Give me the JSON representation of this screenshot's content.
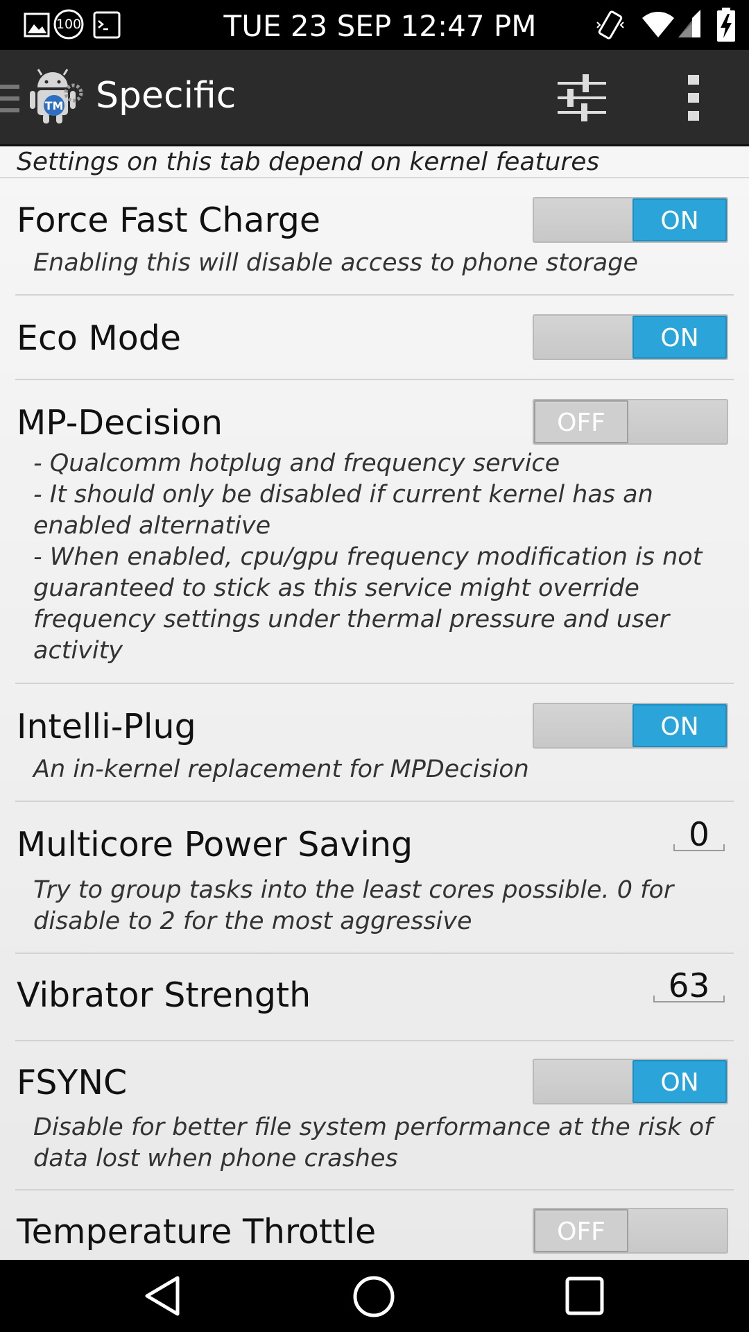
{
  "status_bar": {
    "time": "TUE 23 SEP 12:47 PM",
    "icons": [
      "picture-icon",
      "battery-100-badge-icon",
      "terminal-icon",
      "vibrate-icon",
      "wifi-icon",
      "signal-icon",
      "battery-charging-icon"
    ],
    "badge": "100"
  },
  "action_bar": {
    "title": "Specific",
    "icons": [
      "drawer-icon",
      "app-logo",
      "tune-sliders-icon",
      "overflow-menu-icon"
    ]
  },
  "tab_note": "Settings on this tab depend on kernel features",
  "settings": [
    {
      "title": "Force Fast Charge",
      "control": "toggle",
      "state": "ON",
      "description": "Enabling this will disable access to phone storage"
    },
    {
      "title": "Eco Mode",
      "control": "toggle",
      "state": "ON"
    },
    {
      "title": "MP-Decision",
      "control": "toggle",
      "state": "OFF",
      "description_lines": [
        "- Qualcomm hotplug and frequency service",
        "- It should only be disabled if current kernel has an",
        "enabled alternative",
        "- When enabled, cpu/gpu frequency modification is not",
        "guaranteed to stick as this service might override",
        "frequency settings under thermal pressure and user",
        "activity"
      ]
    },
    {
      "title": "Intelli-Plug",
      "control": "toggle",
      "state": "ON",
      "description": "An in-kernel replacement for MPDecision"
    },
    {
      "title": "Multicore Power Saving",
      "control": "number",
      "value": "0",
      "description_lines": [
        "Try to group tasks into the least cores possible. 0 for",
        "disable to 2 for the most aggressive"
      ]
    },
    {
      "title": "Vibrator Strength",
      "control": "number",
      "value": "63"
    },
    {
      "title": "FSYNC",
      "control": "toggle",
      "state": "ON",
      "description_lines": [
        "Disable for better file system performance at the risk of",
        "data lost when phone crashes"
      ]
    },
    {
      "title": "Temperature Throttle",
      "control": "toggle",
      "state": "OFF"
    }
  ],
  "colors": {
    "toggle_on": "#2ba5d9",
    "action_bar": "#2b2b2b",
    "status_bar": "#000000"
  },
  "nav_bar": {
    "icons": [
      "back-icon",
      "home-icon",
      "recents-icon"
    ]
  }
}
